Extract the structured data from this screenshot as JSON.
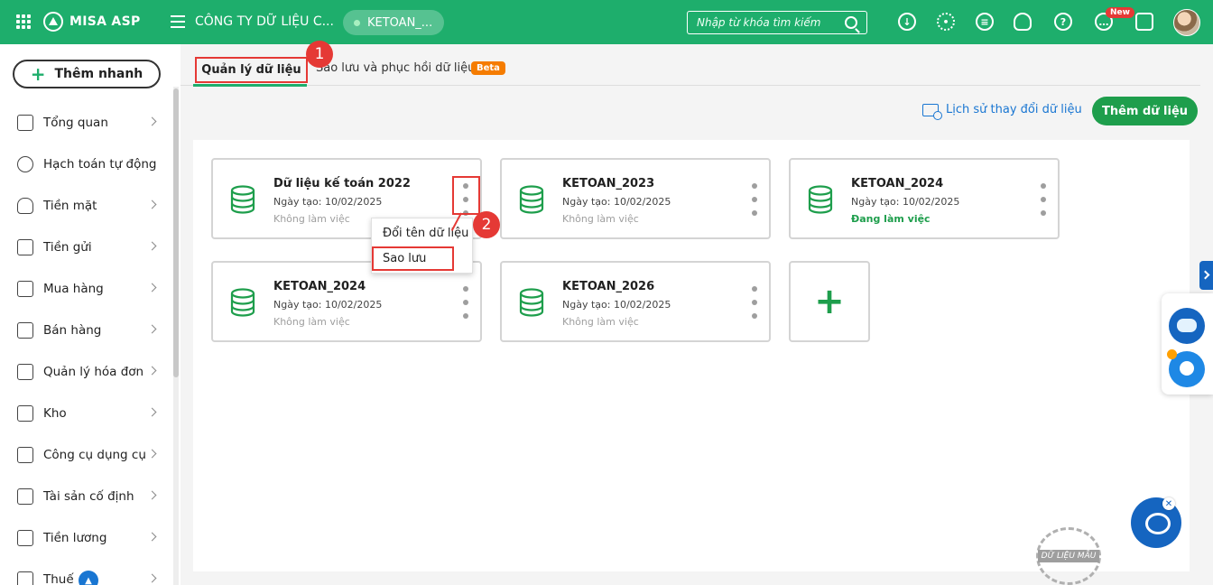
{
  "header": {
    "brand": "MISA ASP",
    "company": "CÔNG TY DỮ LIỆU C...",
    "current_db": "KETOAN_...",
    "search_placeholder": "Nhập từ khóa tìm kiếm",
    "new_badge": "New",
    "icons": [
      "download-icon",
      "gear-icon",
      "chat-icon",
      "bell-icon",
      "help-icon",
      "feedback-icon",
      "light-icon"
    ]
  },
  "sidebar": {
    "quick_add": "Thêm nhanh",
    "items": [
      {
        "label": "Tổng quan",
        "icon": "dashboard-icon"
      },
      {
        "label": "Hạch toán tự động",
        "icon": "auto-gear-icon"
      },
      {
        "label": "Tiền mặt",
        "icon": "money-bag-icon"
      },
      {
        "label": "Tiền gửi",
        "icon": "bank-icon"
      },
      {
        "label": "Mua hàng",
        "icon": "shopping-bag-icon"
      },
      {
        "label": "Bán hàng",
        "icon": "cart-icon"
      },
      {
        "label": "Quản lý hóa đơn",
        "icon": "invoice-icon"
      },
      {
        "label": "Kho",
        "icon": "warehouse-icon"
      },
      {
        "label": "Công cụ dụng cụ",
        "icon": "tools-icon"
      },
      {
        "label": "Tài sản cố định",
        "icon": "fixed-asset-icon"
      },
      {
        "label": "Tiền lương",
        "icon": "salary-icon"
      },
      {
        "label": "Thuế",
        "icon": "tax-icon"
      }
    ]
  },
  "tabs": {
    "active": "Quản lý dữ liệu",
    "second": "Sao lưu và phục hồi dữ liệu",
    "beta": "Beta"
  },
  "steps": [
    "1",
    "2"
  ],
  "actions": {
    "history": "Lịch sử thay đổi dữ liệu",
    "add_data": "Thêm dữ liệu"
  },
  "cards": [
    {
      "title": "Dữ liệu kế toán 2022",
      "date": "Ngày tạo: 10/02/2025",
      "status": "Không làm việc"
    },
    {
      "title": "KETOAN_2023",
      "date": "Ngày tạo: 10/02/2025",
      "status": "Không làm việc"
    },
    {
      "title": "KETOAN_2024",
      "date": "Ngày tạo: 10/02/2025",
      "status": "Đang làm việc"
    },
    {
      "title": "KETOAN_2024",
      "date": "Ngày tạo: 10/02/2025",
      "status": "Không làm việc"
    },
    {
      "title": "KETOAN_2026",
      "date": "Ngày tạo: 10/02/2025",
      "status": "Không làm việc"
    }
  ],
  "context_menu": {
    "rename": "Đổi tên dữ liệu",
    "backup": "Sao lưu"
  },
  "stamp": "DỮ LIỆU MẪU",
  "colors": {
    "brand_green": "#1eae6c",
    "highlight_red": "#e53935",
    "link_blue": "#1976d2",
    "beta_orange": "#f57c00"
  }
}
